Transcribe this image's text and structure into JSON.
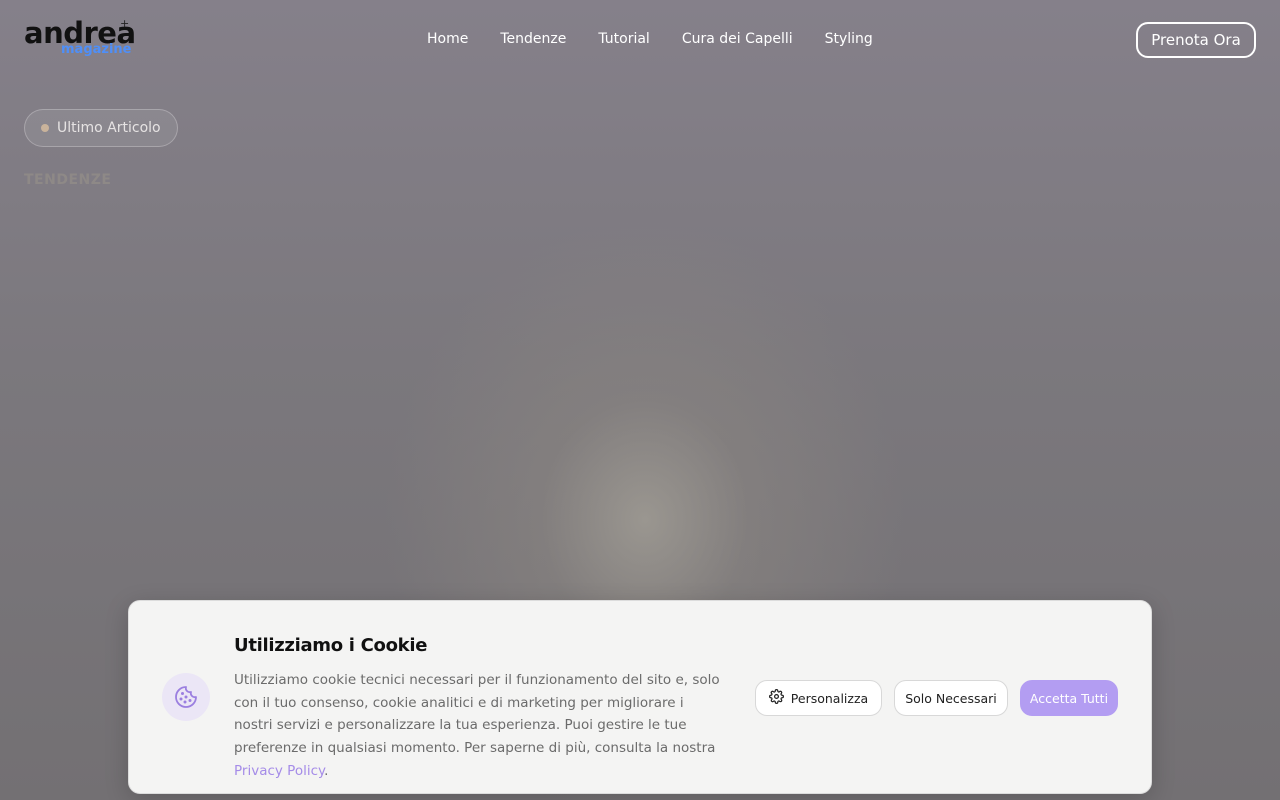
{
  "brand": {
    "logo_main": "andrea",
    "logo_sub": "magazine",
    "logo_plus": "+",
    "accent_color": "#4f8ff7"
  },
  "nav": {
    "items": [
      "Home",
      "Tendenze",
      "Tutorial",
      "Cura dei Capelli",
      "Styling"
    ],
    "cta": "Prenota Ora"
  },
  "hero": {
    "badge": "Ultimo Articolo",
    "category": "TENDENZE"
  },
  "cookie_banner": {
    "title": "Utilizziamo i Cookie",
    "text": "Utilizziamo cookie tecnici necessari per il funzionamento del sito e, solo con il tuo consenso, cookie analitici e di marketing per migliorare i nostri servizi e personalizzare la tua esperienza. Puoi gestire le tue preferenze in qualsiasi momento. Per saperne di più, consulta la nostra",
    "link": "Privacy Policy",
    "link_suffix": ".",
    "buttons": {
      "customize": "Personalizza",
      "necessary": "Solo Necessari",
      "accept": "Accetta Tutti"
    },
    "icons": {
      "banner": "cookie-icon",
      "customize": "gear-icon"
    },
    "accent_color": "#b39df2"
  }
}
